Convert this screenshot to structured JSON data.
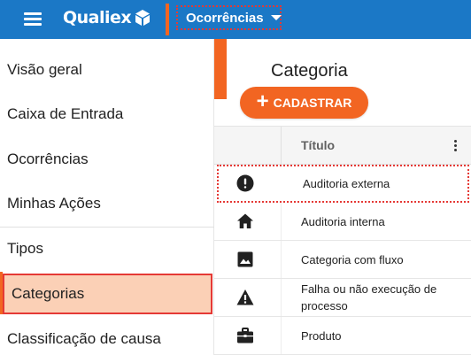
{
  "header": {
    "brand": "Qualiex",
    "module": "Ocorrências",
    "colors": {
      "bar": "#1b78c6",
      "accent": "#f26522"
    }
  },
  "sidebar": {
    "items": [
      {
        "label": "Visão geral"
      },
      {
        "label": "Caixa de Entrada"
      },
      {
        "label": "Ocorrências"
      },
      {
        "label": "Minhas Ações"
      },
      {
        "label": "Tipos"
      },
      {
        "label": "Categorias",
        "active": true
      },
      {
        "label": "Classificação de causa"
      }
    ]
  },
  "main": {
    "title": "Categoria",
    "create_button": {
      "icon": "plus-icon",
      "label": "CADASTRAR"
    },
    "table": {
      "column_title": "Título",
      "rows": [
        {
          "icon": "alert-circle-icon",
          "title": "Auditoria externa"
        },
        {
          "icon": "home-icon",
          "title": "Auditoria interna"
        },
        {
          "icon": "image-icon",
          "title": "Categoria com fluxo"
        },
        {
          "icon": "warning-icon",
          "title_line1": "Falha ou não execução de",
          "title_line2": "processo"
        },
        {
          "icon": "briefcase-icon",
          "title": "Produto"
        }
      ]
    }
  }
}
